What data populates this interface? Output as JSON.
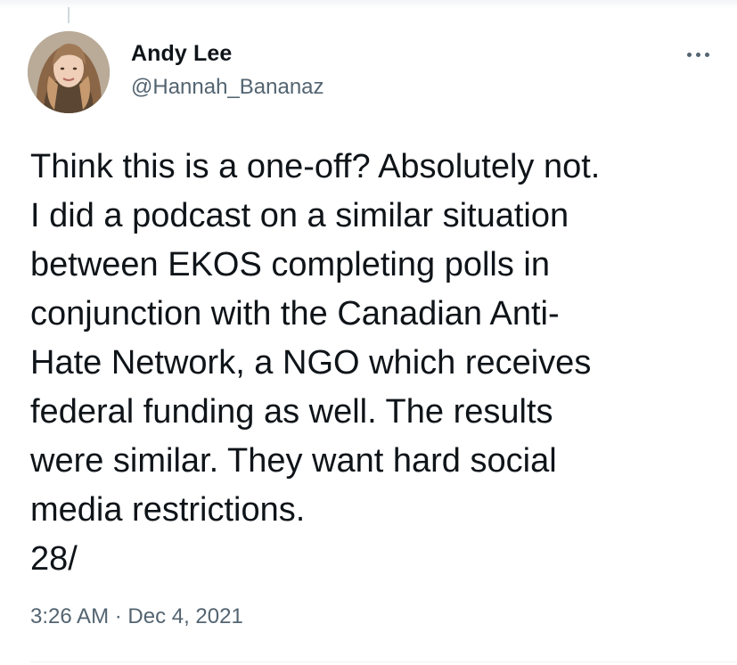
{
  "author": {
    "display_name": "Andy Lee",
    "handle": "@Hannah_Bananaz"
  },
  "more_icon": "more-horizontal-icon",
  "tweet": {
    "lines": [
      "Think this is a one-off? Absolutely not.",
      "I did a podcast on a similar situation",
      "between EKOS completing polls in",
      "conjunction with the Canadian Anti-",
      "Hate Network, a NGO which receives",
      "federal funding as well. The results",
      "were similar. They want hard social",
      "media restrictions.",
      "28/"
    ],
    "timestamp": "3:26 AM · Dec 4, 2021"
  },
  "colors": {
    "text_primary": "#0f1419",
    "text_secondary": "#536471",
    "divider": "#eff3f4"
  }
}
